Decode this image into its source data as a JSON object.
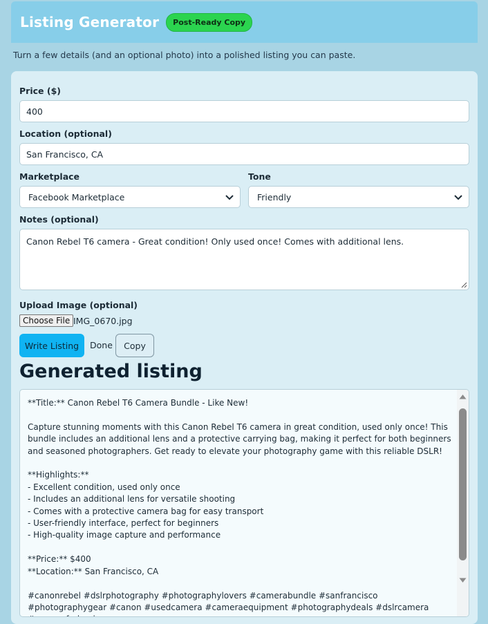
{
  "header": {
    "title": "Listing Generator",
    "badge": "Post-Ready Copy"
  },
  "subtitle": "Turn a few details (and an optional photo) into a polished listing you can paste.",
  "form": {
    "price_label": "Price ($)",
    "price_value": "400",
    "location_label": "Location (optional)",
    "location_value": "San Francisco, CA",
    "marketplace_label": "Marketplace",
    "marketplace_value": "Facebook Marketplace",
    "tone_label": "Tone",
    "tone_value": "Friendly",
    "notes_label": "Notes (optional)",
    "notes_value": "Canon Rebel T6 camera - Great condition!  Only used once!  Comes with additional lens.",
    "upload_label": "Upload Image (optional)",
    "choose_file_label": "Choose File",
    "file_name": "IMG_0670.jpg"
  },
  "actions": {
    "write_label": "Write Listing",
    "status": "Done",
    "copy_label": "Copy"
  },
  "output": {
    "heading": "Generated listing",
    "text": "**Title:** Canon Rebel T6 Camera Bundle - Like New!\n\nCapture stunning moments with this Canon Rebel T6 camera in great condition, used only once! This bundle includes an additional lens and a protective carrying bag, making it perfect for both beginners and seasoned photographers. Get ready to elevate your photography game with this reliable DSLR!\n\n**Highlights:**\n- Excellent condition, used only once\n- Includes an additional lens for versatile shooting\n- Comes with a protective camera bag for easy transport\n- User-friendly interface, perfect for beginners\n- High-quality image capture and performance\n\n**Price:** $400\n**Location:** San Francisco, CA\n\n#canonrebel #dslrphotography #photographylovers #camerabundle #sanfrancisco #photographygear #canon #usedcamera #cameraequipment #photographydeals #dslrcamera #cameraforbeginners"
  },
  "colors": {
    "header_bg": "#87cee9",
    "page_bg": "#a8d4e4",
    "card_bg": "#daeef5",
    "badge_bg": "#2bd44f",
    "primary_button": "#10b3f2"
  },
  "icons": {
    "select_arrow": "chevron-down-icon",
    "resize": "resize-handle-icon"
  }
}
